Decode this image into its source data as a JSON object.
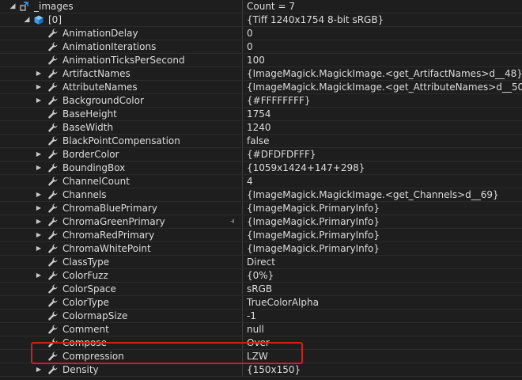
{
  "watch": {
    "root": {
      "name": "_images",
      "value": "Count = 7",
      "arrow": "◢",
      "icon": "object-icon"
    },
    "item": {
      "name": "[0]",
      "value": "{Tiff 1240x1754 8-bit sRGB}",
      "arrow": "◢",
      "icon": "cube-icon"
    },
    "properties": [
      {
        "name": "AnimationDelay",
        "value": "0",
        "expandable": false
      },
      {
        "name": "AnimationIterations",
        "value": "0",
        "expandable": false
      },
      {
        "name": "AnimationTicksPerSecond",
        "value": "100",
        "expandable": false
      },
      {
        "name": "ArtifactNames",
        "value": "{ImageMagick.MagickImage.<get_ArtifactNames>d__48}",
        "expandable": true
      },
      {
        "name": "AttributeNames",
        "value": "{ImageMagick.MagickImage.<get_AttributeNames>d__50}",
        "expandable": true
      },
      {
        "name": "BackgroundColor",
        "value": "{#FFFFFFFF}",
        "expandable": true
      },
      {
        "name": "BaseHeight",
        "value": "1754",
        "expandable": false
      },
      {
        "name": "BaseWidth",
        "value": "1240",
        "expandable": false
      },
      {
        "name": "BlackPointCompensation",
        "value": "false",
        "expandable": false
      },
      {
        "name": "BorderColor",
        "value": "{#DFDFDFFF}",
        "expandable": true
      },
      {
        "name": "BoundingBox",
        "value": "{1059x1424+147+298}",
        "expandable": true
      },
      {
        "name": "ChannelCount",
        "value": "4",
        "expandable": false
      },
      {
        "name": "Channels",
        "value": "{ImageMagick.MagickImage.<get_Channels>d__69}",
        "expandable": true
      },
      {
        "name": "ChromaBluePrimary",
        "value": "{ImageMagick.PrimaryInfo}",
        "expandable": true
      },
      {
        "name": "ChromaGreenPrimary",
        "value": "{ImageMagick.PrimaryInfo}",
        "expandable": true,
        "pinned": true
      },
      {
        "name": "ChromaRedPrimary",
        "value": "{ImageMagick.PrimaryInfo}",
        "expandable": true
      },
      {
        "name": "ChromaWhitePoint",
        "value": "{ImageMagick.PrimaryInfo}",
        "expandable": true
      },
      {
        "name": "ClassType",
        "value": "Direct",
        "expandable": false
      },
      {
        "name": "ColorFuzz",
        "value": "{0%}",
        "expandable": true
      },
      {
        "name": "ColorSpace",
        "value": "sRGB",
        "expandable": false
      },
      {
        "name": "ColorType",
        "value": "TrueColorAlpha",
        "expandable": false
      },
      {
        "name": "ColormapSize",
        "value": "-1",
        "expandable": false
      },
      {
        "name": "Comment",
        "value": "null",
        "expandable": false
      },
      {
        "name": "Compose",
        "value": "Over",
        "expandable": false
      },
      {
        "name": "Compression",
        "value": "LZW",
        "expandable": false
      },
      {
        "name": "Density",
        "value": "{150x150}",
        "expandable": true
      }
    ],
    "expand_glyph": "▶",
    "pin_glyph": "⫣",
    "icons": {
      "property": "wrench-icon"
    },
    "colors": {
      "background": "#1e1e1e",
      "text": "#dcdcdc",
      "highlight": "#d11e1e",
      "wrench": "#cfcfcf",
      "cube": "#3d9be9"
    }
  }
}
